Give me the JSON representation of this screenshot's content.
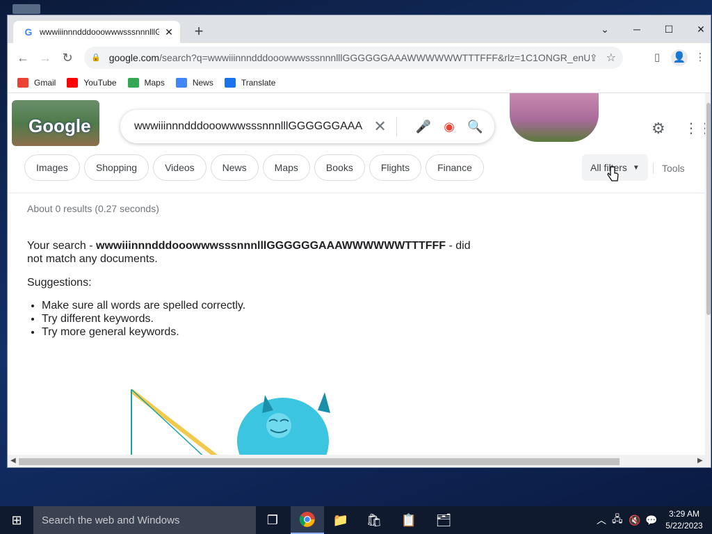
{
  "browser": {
    "tab_title": "wwwiiinnndddooowwwsssnnnlllG",
    "tab_close": "✕",
    "new_tab": "+",
    "url_domain": "google.com",
    "url_rest": "/search?q=wwwiiinnndddooowwwsssnnnlllGGGGGGAAAWWWWWWTTTFFF&rlz=1C1ONGR_enUS1...",
    "controls": {
      "minimize": "─",
      "maximize": "☐",
      "close": "✕",
      "dropdown": "⌄"
    }
  },
  "bookmarks": [
    {
      "label": "Gmail",
      "color": "#ea4335"
    },
    {
      "label": "YouTube",
      "color": "#ff0000"
    },
    {
      "label": "Maps",
      "color": "#34a853"
    },
    {
      "label": "News",
      "color": "#4285f4"
    },
    {
      "label": "Translate",
      "color": "#4285f4"
    }
  ],
  "search": {
    "logo_text": "Google",
    "query": "wwwiiinnndddooowwwsssnnnlllGGGGGGAAAWWWWWWTTTFFF",
    "chips": [
      "Images",
      "Shopping",
      "Videos",
      "News",
      "Maps",
      "Books",
      "Flights",
      "Finance"
    ],
    "all_filters": "All filters",
    "tools": "Tools",
    "stats": "About 0 results (0.27 seconds)",
    "no_match_prefix": "Your search - ",
    "no_match_query": "wwwiiinnndddooowwwsssnnnlllGGGGGGAAAWWWWWWTTTFFF",
    "no_match_suffix": " - did not match any documents.",
    "suggestions_title": "Suggestions:",
    "suggestions": [
      "Make sure all words are spelled correctly.",
      "Try different keywords.",
      "Try more general keywords."
    ]
  },
  "taskbar": {
    "search_placeholder": "Search the web and Windows",
    "time": "3:29 AM",
    "date": "5/22/2023"
  }
}
